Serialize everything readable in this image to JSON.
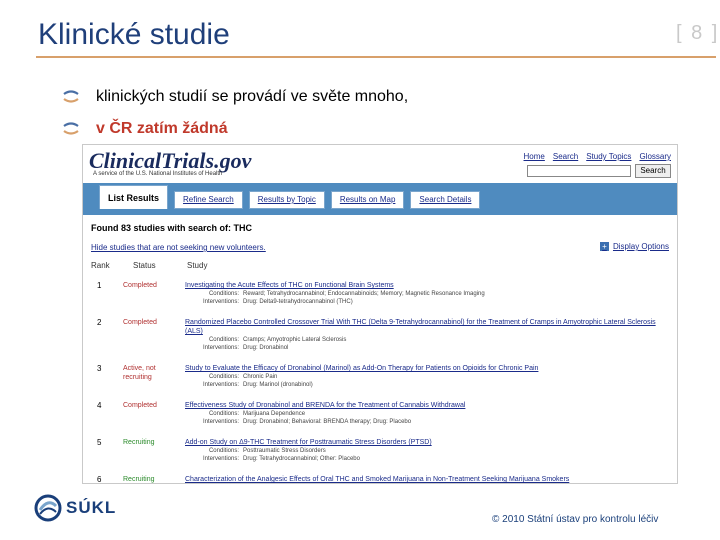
{
  "slide": {
    "title": "Klinické studie",
    "page_number": "[ 8 ]",
    "bullets": [
      "klinických studií se provádí ve světe mnoho,",
      "v ČR zatím žádná"
    ],
    "footer": "© 2010 Státní ústav pro kontrolu léčiv",
    "logo_text": "SÚKL"
  },
  "ct": {
    "logo": "ClinicalTrials.gov",
    "tagline": "A service of the U.S. National Institutes of Health",
    "top_links": [
      "Home",
      "Search",
      "Study Topics",
      "Glossary"
    ],
    "search_button": "Search",
    "tabs": [
      "List Results",
      "Refine Search",
      "Results by Topic",
      "Results on Map",
      "Search Details"
    ],
    "found": "Found 83 studies with search of:   THC",
    "hide_link": "Hide studies that are not seeking new volunteers.",
    "display_options": "Display Options",
    "columns": {
      "rank": "Rank",
      "status": "Status",
      "study": "Study"
    },
    "rows": [
      {
        "rank": "1",
        "status": "Completed",
        "title": "Investigating the Acute Effects of THC on Functional Brain Systems",
        "conditions": "Reward;  Tetrahydrocannabinol;  Endocannabinoids;  Memory;  Magnetic Resonance Imaging",
        "interventions": "Drug: Delta9-tetrahydrocannabinol (THC)"
      },
      {
        "rank": "2",
        "status": "Completed",
        "title": "Randomized Placebo Controlled Crossover Trial With THC (Delta 9-Tetrahydrocannabinol) for the Treatment of Cramps in Amyotrophic Lateral Sclerosis (ALS)",
        "conditions": "Cramps;  Amyotrophic Lateral Sclerosis",
        "interventions": "Drug: Dronabinol"
      },
      {
        "rank": "3",
        "status": "Active, not recruiting",
        "title": "Study to Evaluate the Efficacy of Dronabinol (Marinol) as Add-On Therapy for Patients on Opioids for Chronic Pain",
        "conditions": "Chronic Pain",
        "interventions": "Drug: Marinol (dronabinol)"
      },
      {
        "rank": "4",
        "status": "Completed",
        "title": "Effectiveness Study of Dronabinol and BRENDA for the Treatment of Cannabis Withdrawal",
        "conditions": "Marijuana Dependence",
        "interventions": "Drug: Dronabinol;  Behavioral: BRENDA therapy;  Drug: Placebo"
      },
      {
        "rank": "5",
        "status": "Recruiting",
        "title": "Add-on Study on Δ9-THC Treatment for Posttraumatic Stress Disorders (PTSD)",
        "conditions": "Posttraumatic Stress Disorders",
        "interventions": "Drug: Tetrahydrocannabinol;  Other: Placebo"
      },
      {
        "rank": "6",
        "status": "Recruiting",
        "title": "Characterization of the Analgesic Effects of Oral THC and Smoked Marijuana in Non-Treatment Seeking Marijuana Smokers",
        "conditions": "",
        "interventions": ""
      }
    ],
    "labels": {
      "conditions": "Conditions:",
      "interventions": "Interventions:"
    }
  }
}
